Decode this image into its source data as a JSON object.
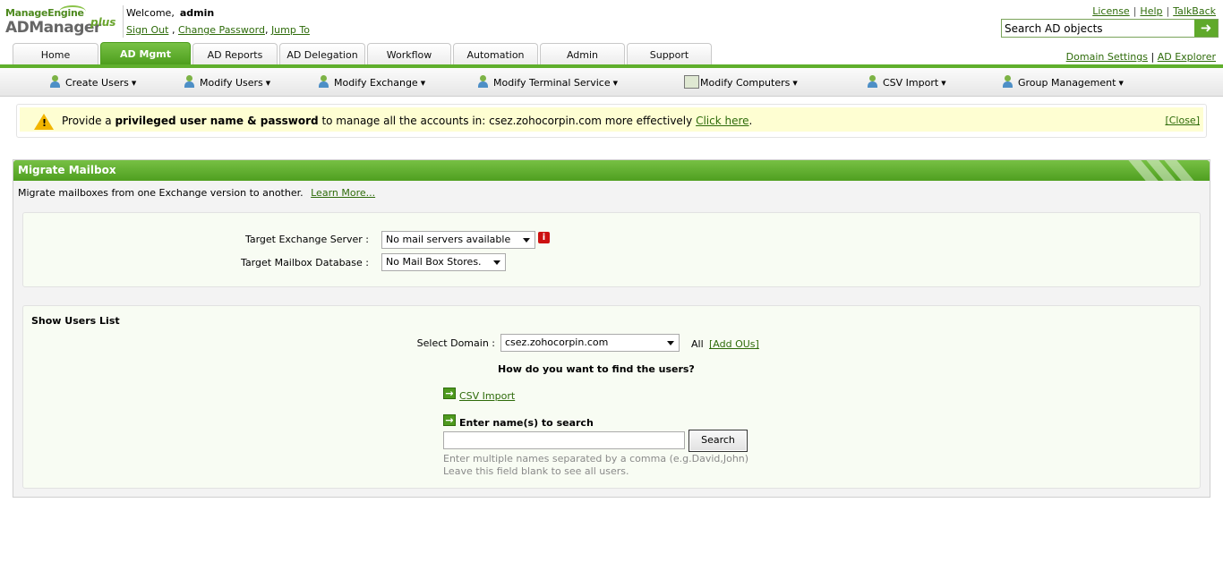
{
  "logo": {
    "brand": "ManageEngine",
    "product": "ADManager",
    "suffix": "plus"
  },
  "header": {
    "welcome": "Welcome,",
    "user": "admin",
    "sign_out": "Sign Out",
    "comma1": ",",
    "change_password": "Change Password",
    "comma2": ",",
    "jump_to": "Jump To",
    "license": "License",
    "help": "Help",
    "talkback": "TalkBack",
    "separator": "|",
    "search_placeholder": "Search AD objects",
    "domain_settings": "Domain Settings",
    "ad_explorer": "AD Explorer"
  },
  "tabs": [
    {
      "label": "Home"
    },
    {
      "label": "AD Mgmt"
    },
    {
      "label": "AD Reports"
    },
    {
      "label": "AD Delegation"
    },
    {
      "label": "Workflow"
    },
    {
      "label": "Automation"
    },
    {
      "label": "Admin"
    },
    {
      "label": "Support"
    }
  ],
  "active_tab": "AD Mgmt",
  "subnav": [
    {
      "label": "Create Users",
      "icon": "create-users-icon"
    },
    {
      "label": "Modify Users",
      "icon": "modify-users-icon"
    },
    {
      "label": "Modify Exchange",
      "icon": "modify-exchange-icon"
    },
    {
      "label": "Modify Terminal Service",
      "icon": "terminal-service-icon"
    },
    {
      "label": "Modify Computers",
      "icon": "computer-icon"
    },
    {
      "label": "CSV Import",
      "icon": "csv-import-icon"
    },
    {
      "label": "Group Management",
      "icon": "group-icon"
    }
  ],
  "alert": {
    "prefix": "Provide a",
    "bold": "privileged user name & password",
    "middle": "to manage all the accounts in: csez.zohocorpin.com more effectively",
    "link": "Click here",
    "suffix": ".",
    "close": "[Close]"
  },
  "panel": {
    "title": "Migrate Mailbox",
    "description": "Migrate mailboxes from one Exchange version to another.",
    "learn_more": "Learn More...",
    "target_server_label": "Target Exchange Server :",
    "target_server_value": "No mail servers available",
    "target_db_label": "Target Mailbox Database :",
    "target_db_value": "No Mail Box Stores."
  },
  "users": {
    "header": "Show Users List",
    "domain_label": "Select Domain :",
    "domain_value": "csez.zohocorpin.com",
    "all": "All",
    "add_ous": "[Add OUs]",
    "question": "How do you want to find the users?",
    "csv_import": "CSV Import",
    "enter_names": "Enter name(s) to search",
    "search_button": "Search",
    "hint1": "Enter multiple names separated by a comma (e.g.David,John)",
    "hint2": "Leave this field blank to see all users."
  },
  "colors": {
    "accent_green": "#5faf2c",
    "alert_bg": "#fefed2",
    "link": "#2e6b0a"
  }
}
